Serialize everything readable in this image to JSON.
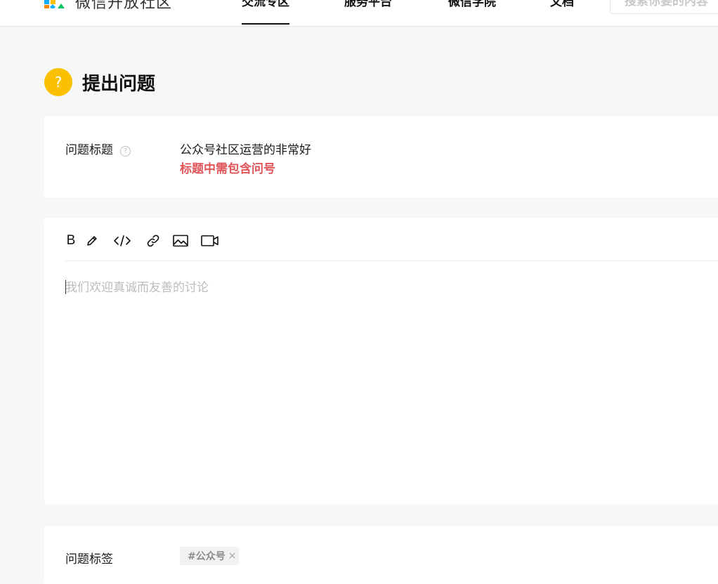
{
  "header": {
    "brand": "微信开放社区",
    "nav": [
      {
        "label": "交流专区",
        "active": true
      },
      {
        "label": "服务平台",
        "active": false
      },
      {
        "label": "微信学院",
        "active": false
      },
      {
        "label": "文档",
        "active": false
      }
    ],
    "search_placeholder": "搜索你要的内容"
  },
  "page": {
    "title": "提出问题",
    "icon_glyph": "?"
  },
  "question_title": {
    "label": "问题标题",
    "help_glyph": "?",
    "value": "公众号社区运营的非常好",
    "error": "标题中需包含问号"
  },
  "editor": {
    "toolbar": [
      {
        "name": "bold",
        "glyph": "B"
      },
      {
        "name": "highlight",
        "icon": "pencil-icon"
      },
      {
        "name": "code",
        "icon": "code-icon"
      },
      {
        "name": "link",
        "icon": "link-icon"
      },
      {
        "name": "image",
        "icon": "image-icon"
      },
      {
        "name": "video",
        "icon": "video-icon"
      }
    ],
    "placeholder": "我们欢迎真诚而友善的讨论"
  },
  "tags": {
    "label": "问题标签",
    "items": [
      {
        "text": "#公众号",
        "remove_glyph": "×"
      }
    ]
  },
  "colors": {
    "accent_yellow": "#fbc000",
    "error_red": "#e0555a",
    "logo": [
      "#fa5151",
      "#10aeff",
      "#fbc000",
      "#07c160",
      "#ff8a00"
    ]
  }
}
